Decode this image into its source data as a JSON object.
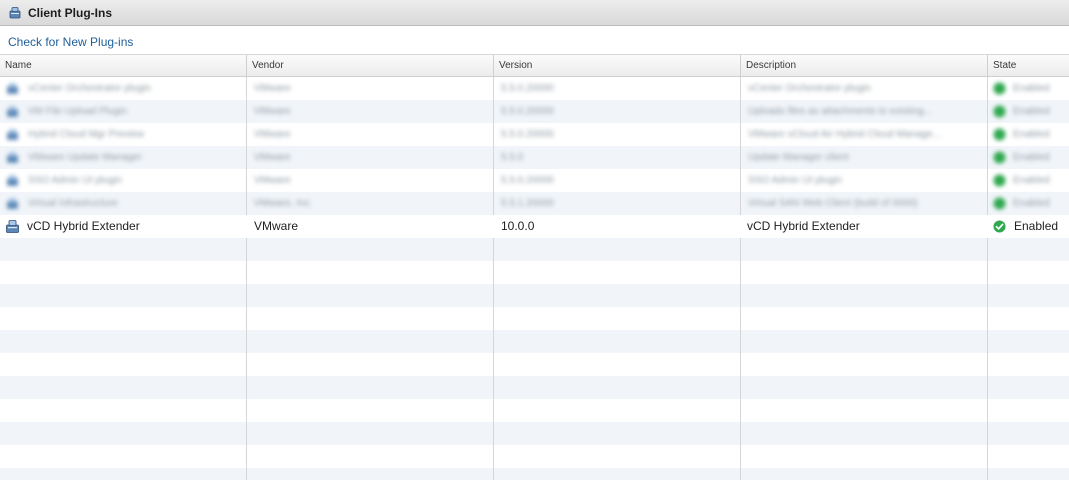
{
  "window": {
    "title": "Client Plug-Ins",
    "title_icon": "plugin-icon"
  },
  "actions": {
    "check_label": "Check for New Plug-ins"
  },
  "table": {
    "columns": [
      "Name",
      "Vendor",
      "Version",
      "Description",
      "State"
    ],
    "blurred_rows": [
      {
        "name": "vCenter Orchestrator plugin",
        "vendor": "VMware",
        "version": "5.5.0.20000",
        "description": "vCenter Orchestrator plugin",
        "state": "Enabled"
      },
      {
        "name": "VM File Upload Plugin",
        "vendor": "VMware",
        "version": "5.5.0.20000",
        "description": "Uploads files as attachments to existing...",
        "state": "Enabled"
      },
      {
        "name": "Hybrid Cloud Mgr Preview",
        "vendor": "VMware",
        "version": "5.5.0.20000",
        "description": "VMware vCloud Air Hybrid Cloud Manage...",
        "state": "Enabled"
      },
      {
        "name": "VMware Update Manager",
        "vendor": "VMware",
        "version": "5.5.0",
        "description": "Update Manager client",
        "state": "Enabled"
      },
      {
        "name": "SSO Admin UI plugin",
        "vendor": "VMware",
        "version": "5.5.0.20000",
        "description": "SSO Admin UI plugin",
        "state": "Enabled"
      },
      {
        "name": "Virtual Infrastructure",
        "vendor": "VMware, Inc.",
        "version": "5.5.1.20000",
        "description": "Virtual SAN Web Client (build of 0000)",
        "state": "Enabled"
      }
    ],
    "highlight_row": {
      "name": "vCD Hybrid Extender",
      "vendor": "VMware",
      "version": "10.0.0",
      "description": "vCD Hybrid Extender",
      "state": "Enabled"
    }
  },
  "colors": {
    "link": "#1f5f9a",
    "row_alt": "#f1f5f9",
    "enabled_green": "#2fa84f"
  }
}
